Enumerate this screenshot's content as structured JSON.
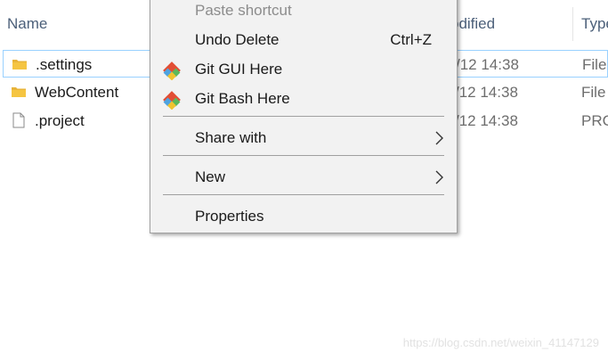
{
  "columns": {
    "name": "Name",
    "modified": "odified",
    "type": "Type"
  },
  "files": [
    {
      "name": ".settings",
      "date": "/12 14:38",
      "type": "File",
      "icon": "folder-icon",
      "selected": true
    },
    {
      "name": "WebContent",
      "date": "/12 14:38",
      "type": "File",
      "icon": "folder-icon",
      "selected": false
    },
    {
      "name": ".project",
      "date": "/12 14:38",
      "type": "PRC",
      "icon": "document-icon",
      "selected": false
    }
  ],
  "context_menu": {
    "paste_shortcut": "Paste shortcut",
    "undo_delete": "Undo Delete",
    "undo_delete_shortcut": "Ctrl+Z",
    "git_gui": "Git GUI Here",
    "git_bash": "Git Bash Here",
    "share_with": "Share with",
    "new": "New",
    "properties": "Properties"
  },
  "watermark": "https://blog.csdn.net/weixin_41147129",
  "colors": {
    "menu_bg": "#f2f2f2",
    "selection_border": "#99d1ff",
    "header_text": "#4c607a",
    "folder_yellow": "#f5c542"
  }
}
